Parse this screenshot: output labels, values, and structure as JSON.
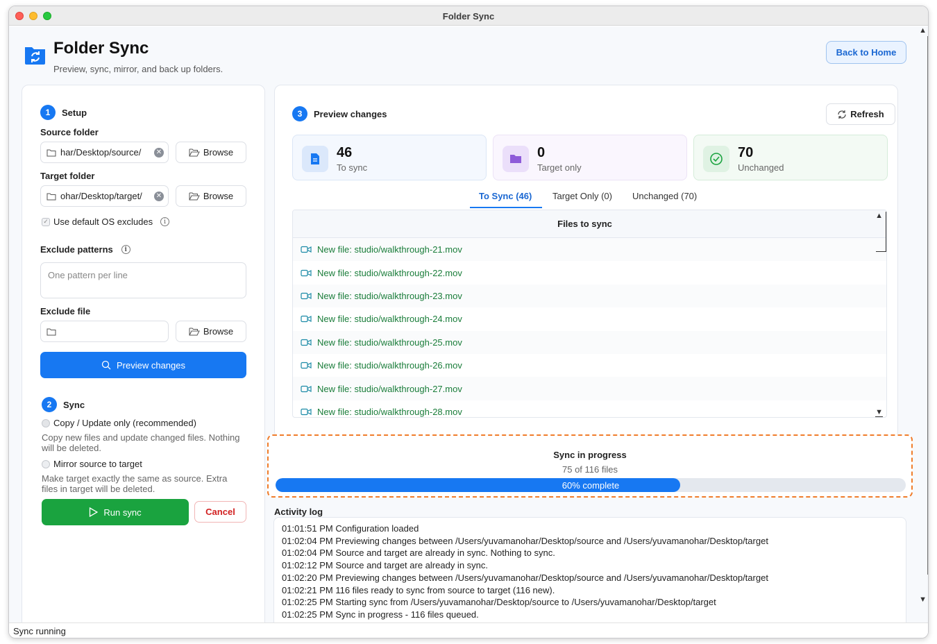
{
  "window": {
    "title": "Folder Sync"
  },
  "header": {
    "title": "Folder Sync",
    "subtitle": "Preview, sync, mirror, and back up folders.",
    "back_button": "Back to Home"
  },
  "setup": {
    "step": "1",
    "title": "Setup",
    "source_label": "Source folder",
    "source_value": "har/Desktop/source/",
    "target_label": "Target folder",
    "target_value": "ohar/Desktop/target/",
    "browse_label": "Browse",
    "default_excludes_label": "Use default OS excludes",
    "exclude_patterns_label": "Exclude patterns",
    "exclude_patterns_placeholder": "One pattern per line",
    "exclude_file_label": "Exclude file",
    "exclude_file_value": "",
    "preview_button": "Preview changes"
  },
  "sync": {
    "step": "2",
    "title": "Sync",
    "copy_option": "Copy / Update only (recommended)",
    "copy_hint": "Copy new files and update changed files. Nothing will be deleted.",
    "mirror_option": "Mirror source to target",
    "mirror_hint": "Make target exactly the same as source. Extra files in target will be deleted.",
    "run_button": "Run sync",
    "cancel_button": "Cancel"
  },
  "preview": {
    "step": "3",
    "title": "Preview changes",
    "refresh_button": "Refresh",
    "stats": [
      {
        "value": "46",
        "caption": "To sync",
        "icon": "file-icon",
        "color": "#1778f2"
      },
      {
        "value": "0",
        "caption": "Target only",
        "icon": "folder-icon",
        "color": "#8e5bd9"
      },
      {
        "value": "70",
        "caption": "Unchanged",
        "icon": "check-circle-icon",
        "color": "#1aa33f"
      }
    ],
    "tabs": [
      "To Sync (46)",
      "Target Only (0)",
      "Unchanged (70)"
    ],
    "active_tab": "To Sync (46)",
    "table_header": "Files to sync",
    "files": [
      "New file: studio/walkthrough-21.mov",
      "New file: studio/walkthrough-22.mov",
      "New file: studio/walkthrough-23.mov",
      "New file: studio/walkthrough-24.mov",
      "New file: studio/walkthrough-25.mov",
      "New file: studio/walkthrough-26.mov",
      "New file: studio/walkthrough-27.mov",
      "New file: studio/walkthrough-28.mov"
    ]
  },
  "progress": {
    "title": "Sync in progress",
    "subtitle": "75 of 116 files",
    "percent": 60,
    "label": "60% complete"
  },
  "log": {
    "title": "Activity log",
    "lines": [
      "01:01:51 PM  Configuration loaded",
      "01:02:04 PM  Previewing changes between /Users/yuvamanohar/Desktop/source and /Users/yuvamanohar/Desktop/target",
      "01:02:04 PM  Source and target are already in sync. Nothing to sync.",
      "01:02:12 PM  Source and target are already in sync.",
      "01:02:20 PM  Previewing changes between /Users/yuvamanohar/Desktop/source and /Users/yuvamanohar/Desktop/target",
      "01:02:21 PM  116 files ready to sync from source to target (116 new).",
      "01:02:25 PM  Starting sync from /Users/yuvamanohar/Desktop/source to /Users/yuvamanohar/Desktop/target",
      "01:02:25 PM  Sync in progress - 116 files queued."
    ]
  },
  "status_bar": {
    "text": "Sync running"
  }
}
